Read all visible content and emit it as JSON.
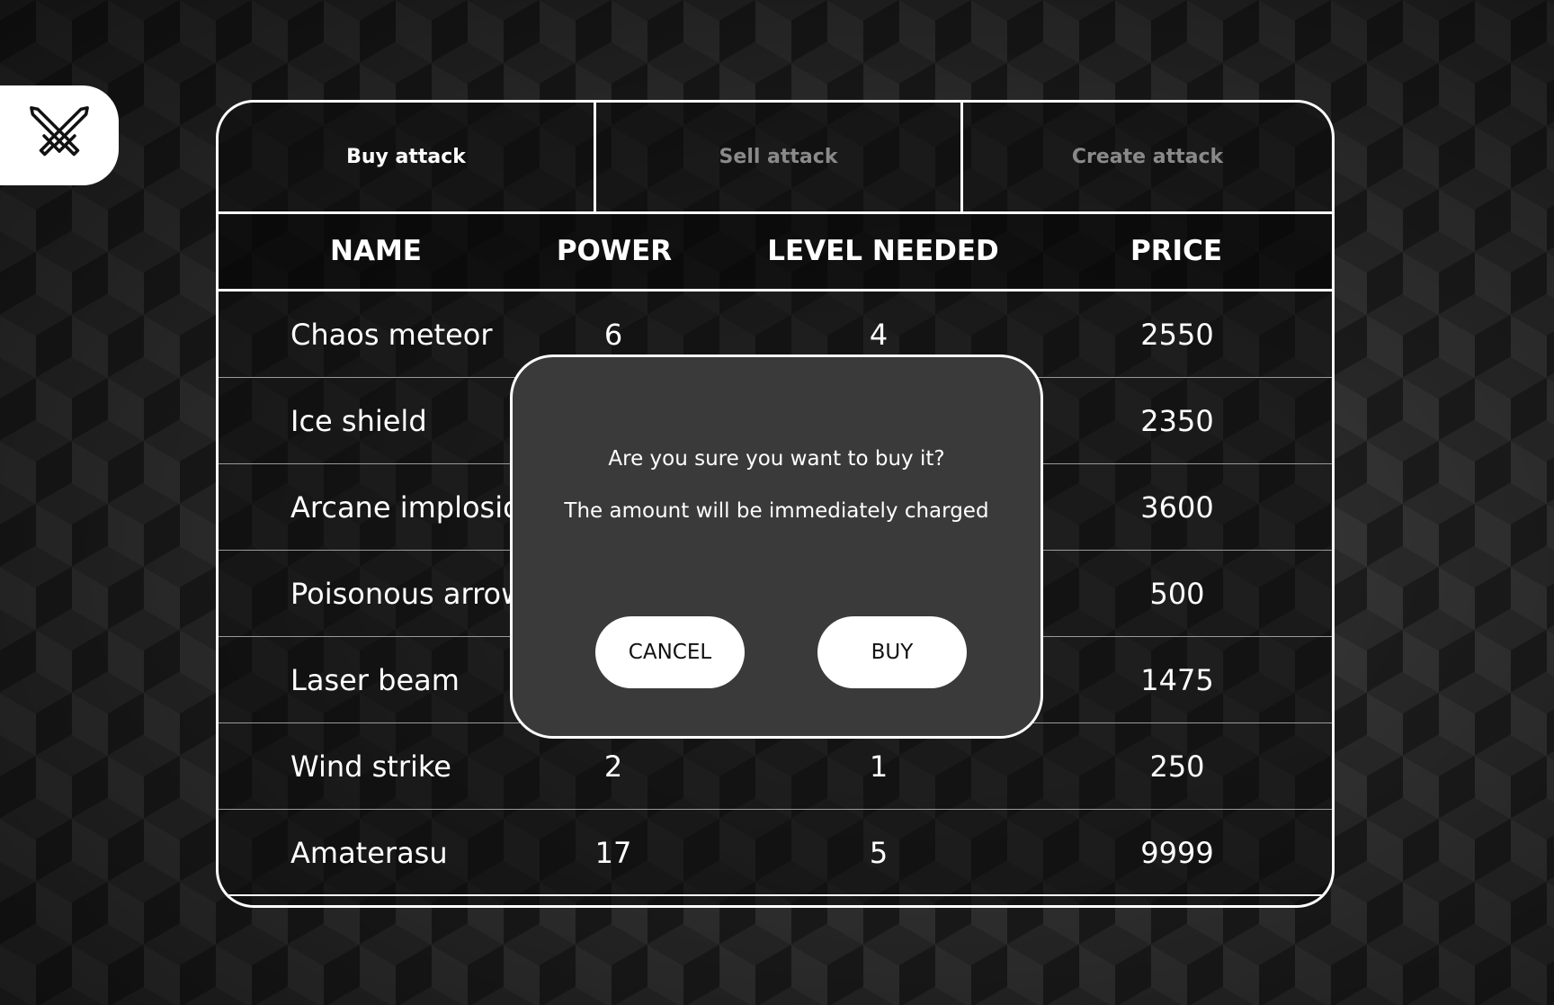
{
  "app": {
    "logo_icon": "crossed-swords-icon"
  },
  "tabs": [
    {
      "label": "Buy attack",
      "active": true
    },
    {
      "label": "Sell attack",
      "active": false
    },
    {
      "label": "Create attack",
      "active": false
    }
  ],
  "table": {
    "headers": {
      "name": "NAME",
      "power": "POWER",
      "level": "LEVEL NEEDED",
      "price": "PRICE"
    },
    "rows": [
      {
        "name": "Chaos meteor",
        "power": "6",
        "level": "4",
        "price": "2550"
      },
      {
        "name": "Ice shield",
        "power": "",
        "level": "",
        "price": "2350"
      },
      {
        "name": "Arcane implosion",
        "power": "",
        "level": "",
        "price": "3600"
      },
      {
        "name": "Poisonous arrow",
        "power": "",
        "level": "",
        "price": "500"
      },
      {
        "name": "Laser beam",
        "power": "",
        "level": "",
        "price": "1475"
      },
      {
        "name": "Wind strike",
        "power": "2",
        "level": "1",
        "price": "250"
      },
      {
        "name": "Amaterasu",
        "power": "17",
        "level": "5",
        "price": "9999"
      }
    ]
  },
  "modal": {
    "question": "Are you sure you want to buy it?",
    "note": "The amount will be immediately charged",
    "cancel_label": "CANCEL",
    "buy_label": "BUY"
  },
  "colors": {
    "accent": "#ffffff",
    "modal_bg": "#3a3a3a",
    "inactive_tab": "#8a8a8a"
  }
}
